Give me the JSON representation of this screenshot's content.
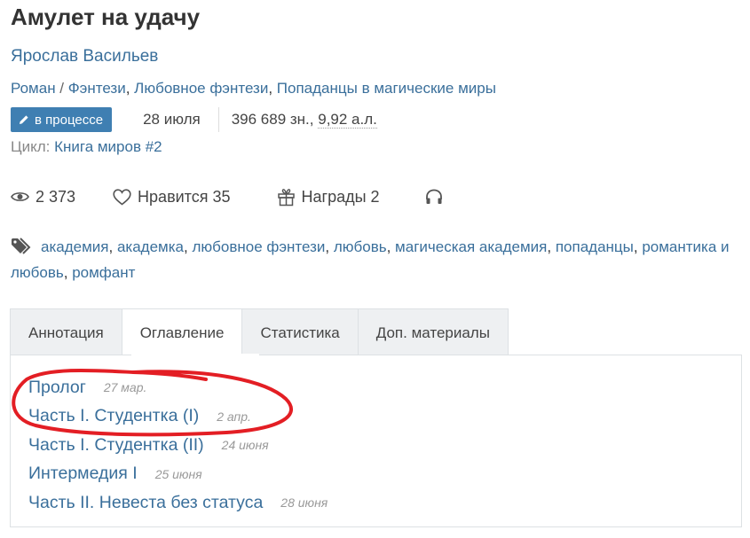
{
  "book": {
    "title": "Амулет на удачу",
    "author": "Ярослав Васильев",
    "genres": {
      "primary": "Роман",
      "separator": " / ",
      "items": [
        "Фэнтези",
        "Любовное фэнтези",
        "Попаданцы в магические миры"
      ]
    },
    "status_label": "в процессе",
    "date": "28 июля",
    "size_chars": "396 689 зн., ",
    "size_al": "9,92 а.л.",
    "cycle_label": "Цикл: ",
    "cycle_name": "Книга миров #2"
  },
  "stats": {
    "views": "2 373",
    "likes_label": "Нравится 35",
    "awards_label": "Награды 2"
  },
  "tags": [
    "академия",
    "академка",
    "любовное фэнтези",
    "любовь",
    "магическая академия",
    "попаданцы",
    "романтика и любовь",
    "ромфант"
  ],
  "tabs": [
    {
      "label": "Аннотация"
    },
    {
      "label": "Оглавление"
    },
    {
      "label": "Статистика"
    },
    {
      "label": "Доп. материалы"
    }
  ],
  "toc": [
    {
      "title": "Пролог",
      "date": "27 мар."
    },
    {
      "title": "Часть I. Студентка (I)",
      "date": "2 апр."
    },
    {
      "title": "Часть I. Студентка (II)",
      "date": "24 июня"
    },
    {
      "title": "Интермедия I",
      "date": "25 июня"
    },
    {
      "title": "Часть II. Невеста без статуса",
      "date": "28 июня"
    }
  ],
  "colors": {
    "link": "#3a6f9b",
    "badge": "#3f7fb2",
    "annotation": "#e31e24"
  }
}
